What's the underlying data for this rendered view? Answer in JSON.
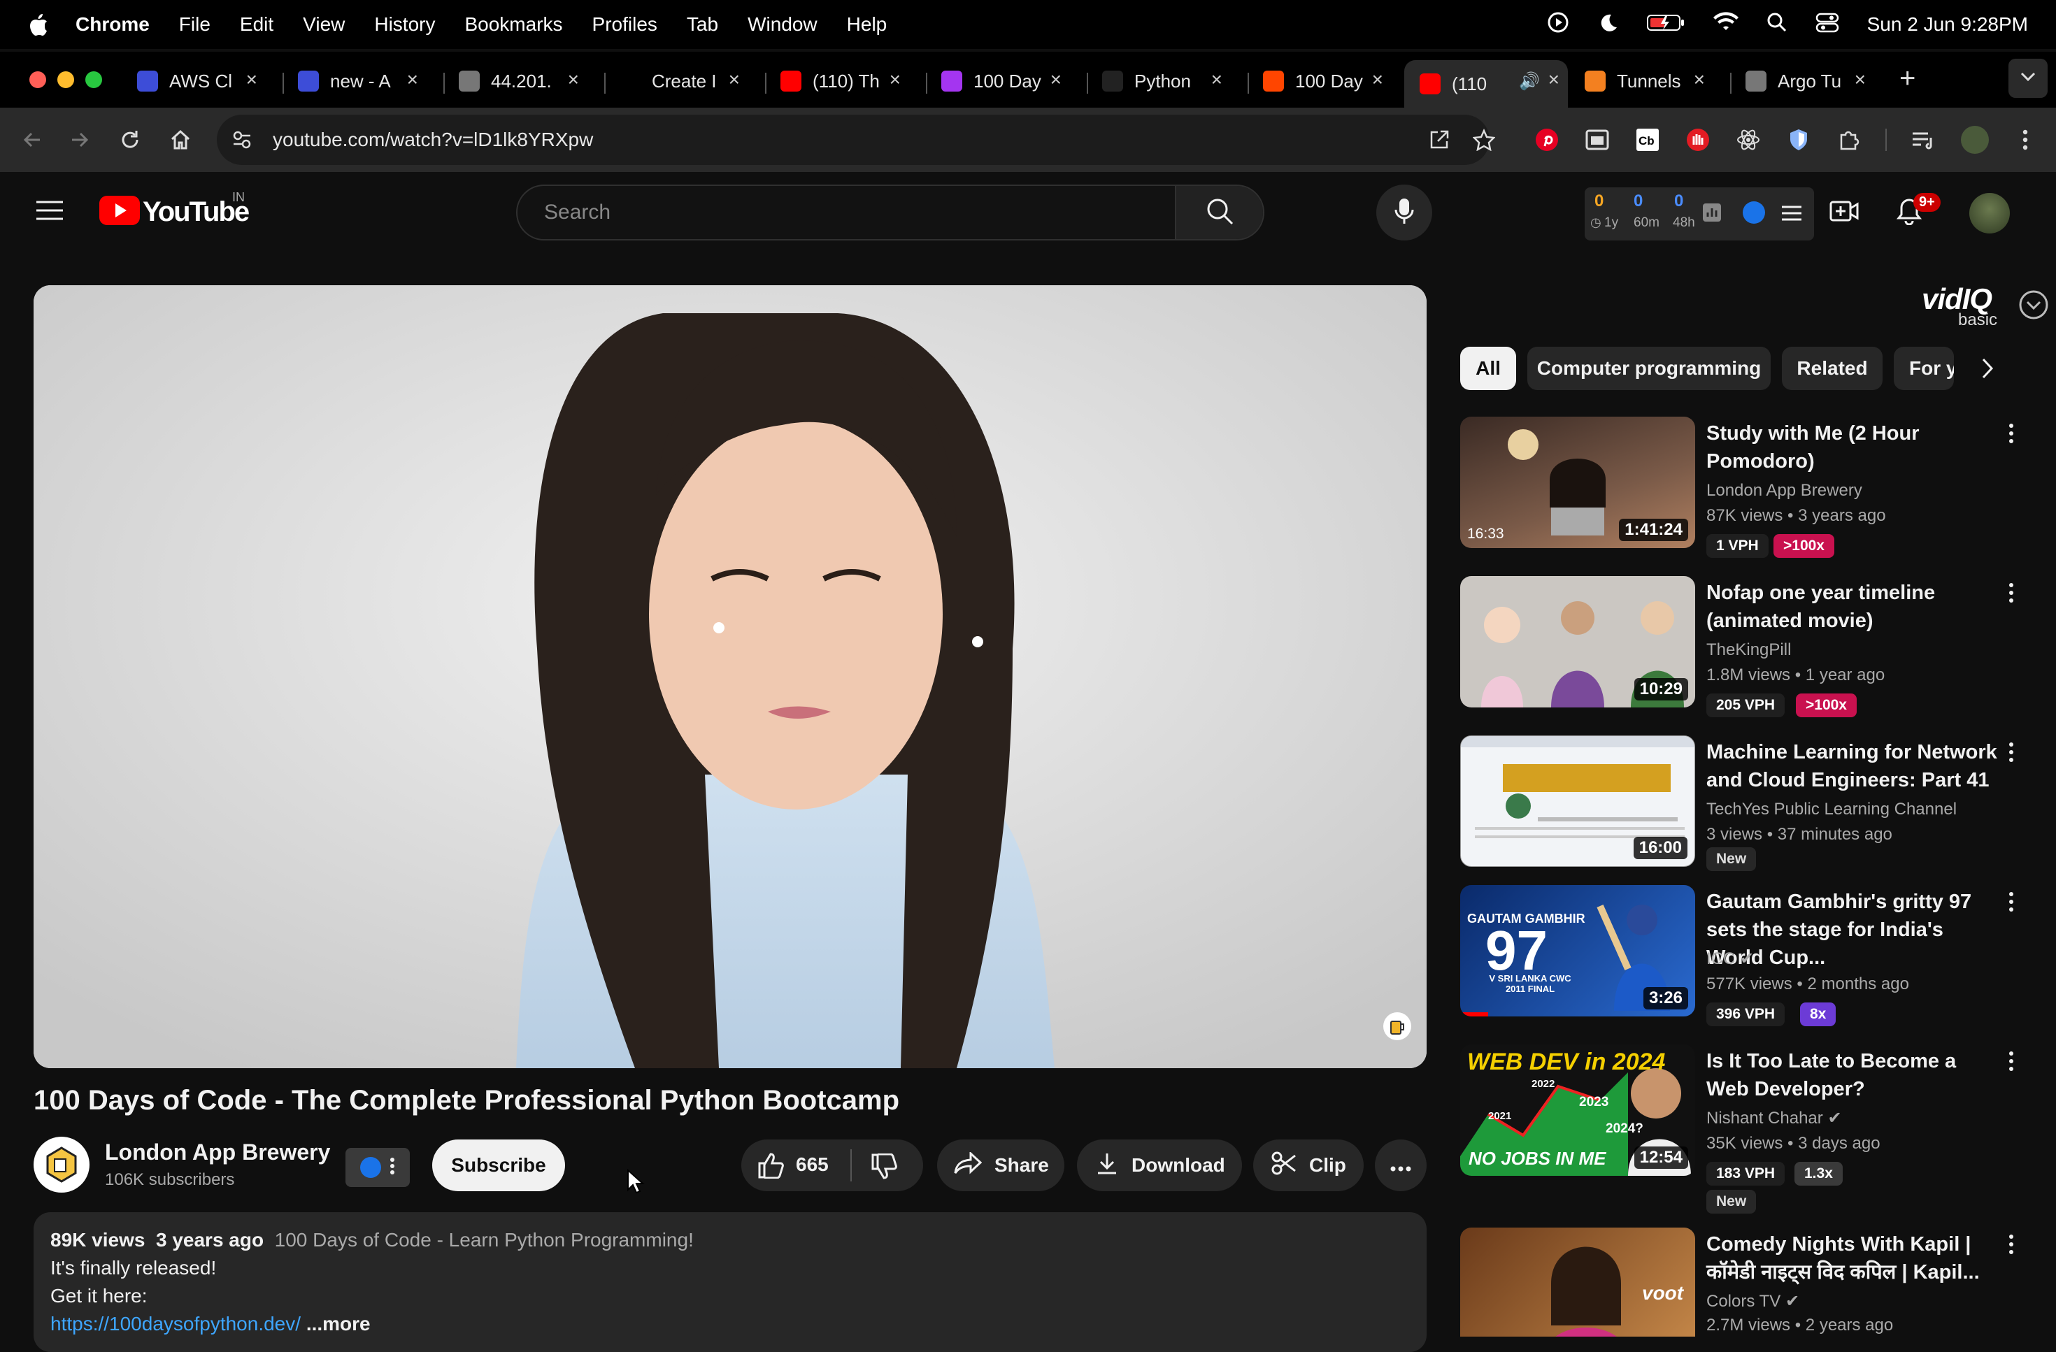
{
  "menubar": {
    "items": [
      "Chrome",
      "File",
      "Edit",
      "View",
      "History",
      "Bookmarks",
      "Profiles",
      "Tab",
      "Window",
      "Help"
    ],
    "datetime": "Sun 2 Jun  9:28PM"
  },
  "tabs": [
    {
      "label": "AWS Cl",
      "favicon": "cloud-icon",
      "color": "#3d4dd8"
    },
    {
      "label": "new - A",
      "favicon": "cloud-icon",
      "color": "#3d4dd8"
    },
    {
      "label": "44.201.",
      "favicon": "globe-icon",
      "color": "#777"
    },
    {
      "label": "Create I",
      "favicon": "triangle-icon",
      "color": "#000"
    },
    {
      "label": "(110) Th",
      "favicon": "youtube-icon",
      "color": "#ff0000"
    },
    {
      "label": "100 Day",
      "favicon": "udemy-icon",
      "color": "#a435f0"
    },
    {
      "label": "Python",
      "favicon": "dot-icon",
      "color": "#222"
    },
    {
      "label": "100 Day",
      "favicon": "reddit-icon",
      "color": "#ff4500"
    },
    {
      "label": "(110",
      "favicon": "youtube-icon",
      "color": "#ff0000"
    },
    {
      "label": "Tunnels",
      "favicon": "cloudflare-icon",
      "color": "#f38020"
    },
    {
      "label": "Argo Tu",
      "favicon": "globe-icon",
      "color": "#777"
    }
  ],
  "omnibox": {
    "url": "youtube.com/watch?v=lD1lk8YRXpw"
  },
  "yt": {
    "logo_text": "YouTube",
    "region": "IN",
    "search_placeholder": "Search",
    "notif_count": "9+"
  },
  "vidiq_stats": {
    "vals": [
      "0",
      "0",
      "0"
    ],
    "labels": [
      "1y",
      "60m",
      "48h"
    ],
    "brand": "vidIQ",
    "tier": "basic"
  },
  "video": {
    "title": "100 Days of Code - The Complete Professional Python Bootcamp",
    "channel": "London App Brewery",
    "subs": "106K subscribers",
    "subscribe": "Subscribe",
    "likes": "665",
    "share": "Share",
    "download": "Download",
    "clip": "Clip"
  },
  "description": {
    "views": "89K views",
    "age": "3 years ago",
    "headline": "100 Days of Code - Learn Python Programming!",
    "line1": "It's finally released!",
    "line2": "Get it here:",
    "link": "https://100daysofpython.dev/",
    "more": "...more"
  },
  "chips": [
    "All",
    "Computer programming",
    "Related",
    "For y"
  ],
  "recs": [
    {
      "title": "Study with Me (2 Hour Pomodoro)",
      "channel": "London App Brewery",
      "views": "87K views",
      "age": "3 years ago",
      "duration": "1:41:24",
      "vph": "1 VPH",
      "mult": ">100x",
      "mult_color": "#c9114f",
      "thumb_color": "#6a4a3a",
      "extra": "16:33"
    },
    {
      "title": "Nofap one year timeline (animated movie)",
      "channel": "TheKingPill",
      "views": "1.8M views",
      "age": "1 year ago",
      "duration": "10:29",
      "vph": "205 VPH",
      "mult": ">100x",
      "mult_color": "#c9114f",
      "thumb_color": "#c9c6c1"
    },
    {
      "title": "Machine Learning for Network and Cloud Engineers: Part 41",
      "channel": "TechYes Public Learning Channel",
      "views": "3 views",
      "age": "37 minutes ago",
      "duration": "16:00",
      "new": "New",
      "thumb_color": "#eef1f5"
    },
    {
      "title": "Gautam Gambhir's gritty 97 sets the stage for India's World Cup...",
      "channel": "ICC",
      "views": "577K views",
      "age": "2 months ago",
      "duration": "3:26",
      "vph": "396 VPH",
      "mult": "8x",
      "mult_color": "#6c3bd6",
      "thumb_color": "#1b4fa8",
      "big": "97",
      "overlay": "GAUTAM GAMBHIR",
      "sub": "V SRI LANKA CWC 2011 FINAL"
    },
    {
      "title": "Is It Too Late to Become a Web Developer?",
      "channel": "Nishant Chahar",
      "views": "35K views",
      "age": "3 days ago",
      "duration": "12:54",
      "vph": "183 VPH",
      "mult": "1.3x",
      "mult_color": "#3a3a3a",
      "new": "New",
      "thumb_color": "#111",
      "overlay": "WEB DEV in 2024",
      "sub": "NO JOBS IN ME",
      "years": [
        "2022",
        "2023",
        "2021",
        "2024?"
      ]
    },
    {
      "title": "Comedy Nights With Kapil | कॉमेडी नाइट्स विद कपिल | Kapil...",
      "channel": "Colors TV",
      "views": "2.7M views",
      "age": "2 years ago",
      "duration": "",
      "thumb_color": "#8a5a2a",
      "overlay": "voot"
    }
  ]
}
